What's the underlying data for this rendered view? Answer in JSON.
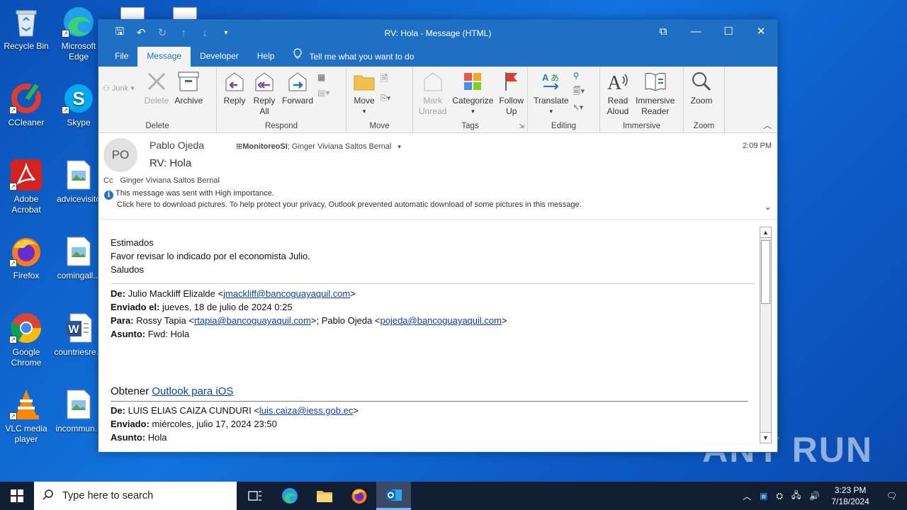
{
  "desktop": {
    "icons": [
      {
        "label": "Recycle Bin",
        "icon": "recycle-bin-icon"
      },
      {
        "label": "Microsoft Edge",
        "icon": "edge-icon"
      },
      {
        "label": "CCleaner",
        "icon": "ccleaner-icon"
      },
      {
        "label": "Skype",
        "icon": "skype-icon"
      },
      {
        "label": "Adobe Acrobat",
        "icon": "acrobat-icon"
      },
      {
        "label": "advicevisito",
        "icon": "image-file-icon"
      },
      {
        "label": "Firefox",
        "icon": "firefox-icon"
      },
      {
        "label": "comingall...",
        "icon": "image-file-icon"
      },
      {
        "label": "Google Chrome",
        "icon": "chrome-icon"
      },
      {
        "label": "countriesre...",
        "icon": "word-file-icon"
      },
      {
        "label": "VLC media player",
        "icon": "vlc-icon"
      },
      {
        "label": "incommun...",
        "icon": "image-file-icon"
      }
    ],
    "watermark": "ANY RUN"
  },
  "window": {
    "title": "RV: Hola  -  Message (HTML)",
    "tabs": [
      "File",
      "Message",
      "Developer",
      "Help"
    ],
    "active_tab": "Message",
    "tell_me": "Tell me what you want to do"
  },
  "ribbon": {
    "delete_group": {
      "label": "Delete",
      "junk": "Junk",
      "delete": "Delete",
      "archive": "Archive"
    },
    "respond_group": {
      "label": "Respond",
      "reply": "Reply",
      "reply_all_1": "Reply",
      "reply_all_2": "All",
      "forward": "Forward"
    },
    "move_group": {
      "label": "Move",
      "move": "Move"
    },
    "tags_group": {
      "label": "Tags",
      "mark_unread_1": "Mark",
      "mark_unread_2": "Unread",
      "categorize": "Categorize",
      "follow_up_1": "Follow",
      "follow_up_2": "Up"
    },
    "editing_group": {
      "label": "Editing",
      "translate": "Translate"
    },
    "immersive_group": {
      "label": "Immersive",
      "read_aloud_1": "Read",
      "read_aloud_2": "Aloud",
      "immersive_reader_1": "Immersive",
      "immersive_reader_2": "Reader"
    },
    "zoom_group": {
      "label": "Zoom",
      "zoom": "Zoom"
    }
  },
  "message": {
    "avatar_initials": "PO",
    "sender": "Pablo Ojeda",
    "to_bold": "MonitoreoSI",
    "to_rest": "; Ginger Viviana Saltos Bernal",
    "subject": "RV: Hola",
    "time": "2:09 PM",
    "cc_label": "Cc",
    "cc": "Ginger Viviana Saltos Bernal",
    "info_line1": "This message was sent with High importance.",
    "info_line2": "Click here to download pictures. To help protect your privacy, Outlook prevented automatic download of some pictures in this message."
  },
  "body": {
    "greeting": "Estimados",
    "line2": "Favor revisar lo indicado por el economista Julio.",
    "line3": "Saludos",
    "fwd1": {
      "de_label": "De:",
      "de_name": "Julio Mackliff Elizalde <",
      "de_email": "jmackliff@bancoguayaquil.com",
      "de_end": ">",
      "enviado_label": "Enviado el:",
      "enviado": "jueves, 18 de julio de 2024 0:25",
      "para_label": "Para:",
      "para_name1": "Rossy Tapia <",
      "para_email1": "rtapia@bancoguayaquil.com",
      "para_mid": ">; Pablo Ojeda <",
      "para_email2": "pojeda@bancoguayaquil.com",
      "para_end": ">",
      "asunto_label": "Asunto:",
      "asunto": "Fwd: Hola"
    },
    "obtener": "Obtener ",
    "obtener_link": "Outlook para iOS",
    "fwd2": {
      "de_label": "De:",
      "de_name": "LUIS ELIAS CAIZA CUNDURI <",
      "de_email": "luis.caiza@iess.gob.ec",
      "de_end": ">",
      "enviado_label": "Enviado:",
      "enviado": "miércoles, julio 17, 2024 23:50",
      "asunto_label": "Asunto:",
      "asunto": "Hola"
    }
  },
  "taskbar": {
    "search_placeholder": "Type here to search",
    "time": "3:23 PM",
    "date": "7/18/2024"
  }
}
